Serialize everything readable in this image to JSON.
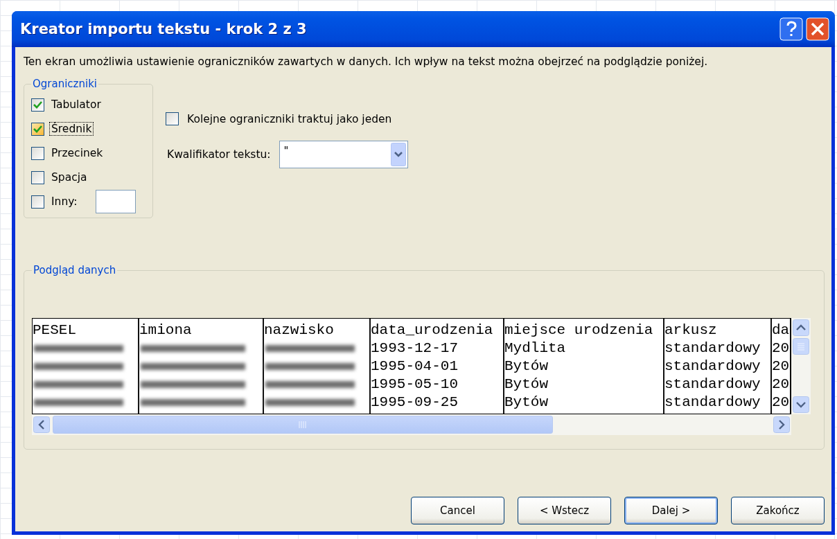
{
  "window": {
    "title": "Kreator importu tekstu - krok 2 z 3"
  },
  "description": "Ten ekran umożliwia ustawienie ograniczników zawartych w danych. Ich wpływ na tekst można obejrzeć na podglądzie poniżej.",
  "delimiters": {
    "legend": "Ograniczniki",
    "options": [
      {
        "kind": "plain",
        "label": "Tabulator",
        "checked": true,
        "focused": false
      },
      {
        "kind": "plain",
        "label": "Średnik",
        "checked": true,
        "focused": true
      },
      {
        "kind": "plain",
        "label": "Przecinek",
        "checked": false,
        "focused": false
      },
      {
        "kind": "plain",
        "label": "Spacja",
        "checked": false,
        "focused": false
      },
      {
        "kind": "with_field",
        "label": "Inny:",
        "checked": false,
        "focused": false
      }
    ]
  },
  "consecutive": {
    "label": "Kolejne ograniczniki traktuj jako jeden",
    "checked": false
  },
  "qualifier": {
    "label": "Kwalifikator tekstu:",
    "value": "\""
  },
  "preview": {
    "legend": "Podgląd danych",
    "columns": [
      "PESEL",
      "imiona",
      "nazwisko",
      "data_urodzenia",
      "miejsce urodzenia",
      "arkusz",
      "da"
    ],
    "rows": [
      {
        "cells": [
          {
            "kind": "redacted"
          },
          {
            "kind": "redacted"
          },
          {
            "kind": "redacted"
          },
          {
            "kind": "text",
            "text": "1993-12-17"
          },
          {
            "kind": "text",
            "text": "Mydlita"
          },
          {
            "kind": "text",
            "text": "standardowy"
          },
          {
            "kind": "text",
            "text": "20"
          }
        ]
      },
      {
        "cells": [
          {
            "kind": "redacted"
          },
          {
            "kind": "redacted"
          },
          {
            "kind": "redacted"
          },
          {
            "kind": "text",
            "text": "1995-04-01"
          },
          {
            "kind": "text",
            "text": "Bytów"
          },
          {
            "kind": "text",
            "text": "standardowy"
          },
          {
            "kind": "text",
            "text": "20"
          }
        ]
      },
      {
        "cells": [
          {
            "kind": "redacted"
          },
          {
            "kind": "redacted"
          },
          {
            "kind": "redacted"
          },
          {
            "kind": "text",
            "text": "1995-05-10"
          },
          {
            "kind": "text",
            "text": "Bytów"
          },
          {
            "kind": "text",
            "text": "standardowy"
          },
          {
            "kind": "text",
            "text": "20"
          }
        ]
      },
      {
        "cells": [
          {
            "kind": "redacted"
          },
          {
            "kind": "redacted"
          },
          {
            "kind": "redacted"
          },
          {
            "kind": "text",
            "text": "1995-09-25"
          },
          {
            "kind": "text",
            "text": "Bytów"
          },
          {
            "kind": "text",
            "text": "standardowy"
          },
          {
            "kind": "text",
            "text": "20"
          }
        ]
      }
    ]
  },
  "buttons": [
    {
      "label": "Cancel",
      "default": false
    },
    {
      "label": "< Wstecz",
      "default": false
    },
    {
      "label": "Dalej >",
      "default": true
    },
    {
      "label": "Zakończ",
      "default": false
    }
  ]
}
